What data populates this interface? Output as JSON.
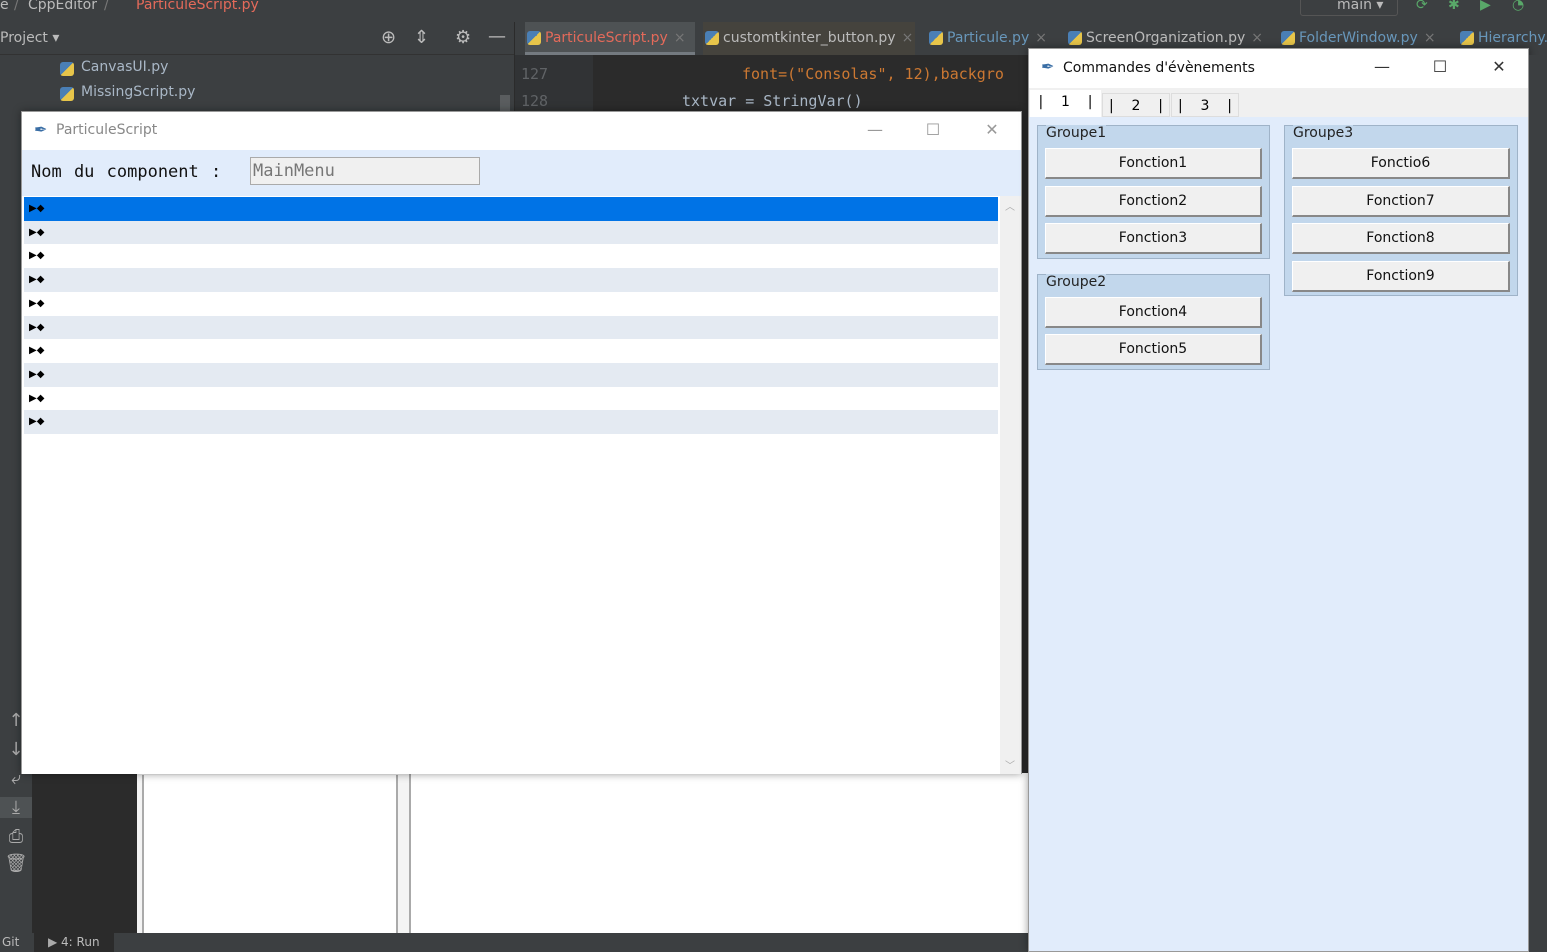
{
  "ide": {
    "breadcrumb": [
      "e",
      "CppEditor",
      "ParticuleScript.py"
    ],
    "branch": "main",
    "project_label": "Project",
    "tabs": [
      {
        "label": "ParticuleScript.py",
        "active": true
      },
      {
        "label": "customtkinter_button.py"
      },
      {
        "label": "Particule.py"
      },
      {
        "label": "ScreenOrganization.py"
      },
      {
        "label": "FolderWindow.py"
      },
      {
        "label": "Hierarchy."
      }
    ],
    "tree_items": [
      "CanvasUI.py",
      "MissingScript.py"
    ],
    "code": [
      {
        "line": "127",
        "text": "font=(\"Consolas\", 12),backgro"
      },
      {
        "line": "128",
        "text": "txtvar = StringVar()"
      }
    ],
    "bottom_tabs": [
      "Git",
      "4: Run"
    ]
  },
  "particule_window": {
    "title": "ParticuleScript",
    "label": "Nom du component :",
    "component_value": "MainMenu",
    "rows": [
      "▶◆",
      "▶◆",
      "▶◆",
      "▶◆",
      "▶◆",
      "▶◆",
      "▶◆",
      "▶◆",
      "▶◆",
      "▶◆"
    ],
    "selected_row": 0
  },
  "events_window": {
    "title": "Commandes d'évènements",
    "tabs": [
      "1",
      "2",
      "3"
    ],
    "active_tab": 0,
    "groups": [
      {
        "label": "Groupe1",
        "buttons": [
          "Fonction1",
          "Fonction2",
          "Fonction3"
        ]
      },
      {
        "label": "Groupe2",
        "buttons": [
          "Fonction4",
          "Fonction5"
        ]
      },
      {
        "label": "Groupe3",
        "buttons": [
          "Fonctio6",
          "Fonction7",
          "Fonction8",
          "Fonction9"
        ]
      }
    ]
  },
  "colors": {
    "selection": "#0073e6",
    "panel": "#e1ecfb",
    "group": "#c2d7ec",
    "tab_active": "#e46a5a"
  }
}
